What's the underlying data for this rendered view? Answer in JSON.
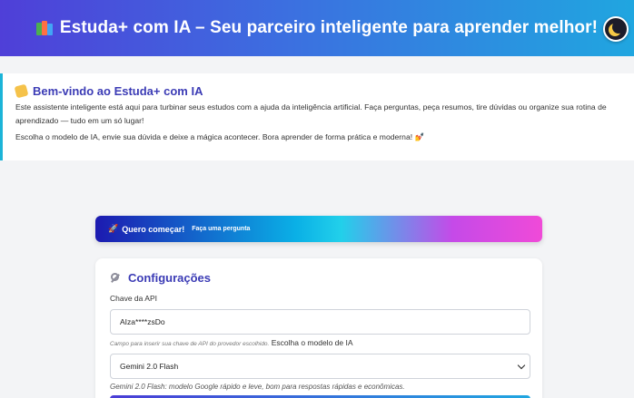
{
  "header": {
    "title": "Estuda+ com IA – Seu parceiro inteligente para aprender melhor!",
    "icon": "books-icon",
    "theme_toggle_icon": "moon-icon"
  },
  "welcome": {
    "title": "Bem-vindo ao Estuda+ com IA",
    "paragraph1": "Este assistente inteligente está aqui para turbinar seus estudos com a ajuda da inteligência artificial. Faça perguntas, peça resumos, tire dúvidas ou organize sua rotina de aprendizado — tudo em um só lugar!",
    "paragraph2": "Escolha o modelo de IA, envie sua dúvida e deixe a mágica acontecer. Bora aprender de forma prática e moderna! 💅"
  },
  "cta": {
    "label": "Quero começar!",
    "sublabel": "Faça uma pergunta"
  },
  "config": {
    "title": "Configurações",
    "api_key_label": "Chave da API",
    "api_key_value": "AIza****zsDo",
    "api_key_hint": "Campo para inserir sua chave de API do provedor escolhido.",
    "model_label": "Escolha o modelo de IA",
    "model_selected": "Gemini 2.0 Flash",
    "model_description": "Gemini 2.0 Flash: modelo Google rápido e leve, bom para respostas rápidas e econômicas."
  },
  "colors": {
    "accent": "#3b3bb5",
    "header_start": "#4f3fd8",
    "header_end": "#20a6e0"
  }
}
